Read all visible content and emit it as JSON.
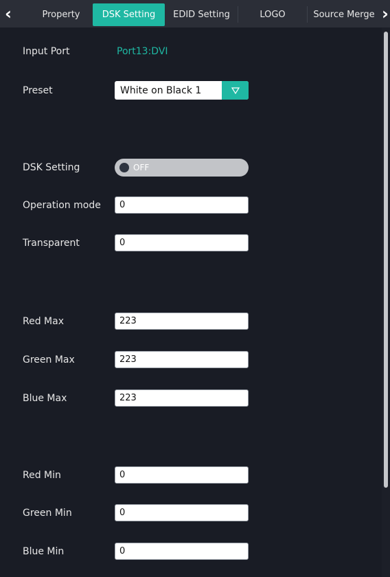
{
  "tabs": {
    "items": [
      {
        "label": "Property",
        "active": false
      },
      {
        "label": "DSK Setting",
        "active": true
      },
      {
        "label": "EDID Setting",
        "active": false
      },
      {
        "label": "LOGO",
        "active": false
      },
      {
        "label": "Source Merge",
        "active": false
      }
    ]
  },
  "form": {
    "input_port": {
      "label": "Input Port",
      "value": "Port13:DVI"
    },
    "preset": {
      "label": "Preset",
      "value": "White on Black 1",
      "icon": "triangle-down-icon"
    },
    "dsk_setting": {
      "label": "DSK Setting",
      "state": "OFF"
    },
    "operation_mode": {
      "label": "Operation mode",
      "value": "0"
    },
    "transparent": {
      "label": "Transparent",
      "value": "0"
    },
    "red_max": {
      "label": "Red Max",
      "value": "223"
    },
    "green_max": {
      "label": "Green Max",
      "value": "223"
    },
    "blue_max": {
      "label": "Blue Max",
      "value": "223"
    },
    "red_min": {
      "label": "Red Min",
      "value": "0"
    },
    "green_min": {
      "label": "Green Min",
      "value": "0"
    },
    "blue_min": {
      "label": "Blue Min",
      "value": "0"
    }
  },
  "colors": {
    "accent": "#1fb8a3",
    "background": "#191c25",
    "tabbar": "#2b2e37"
  }
}
